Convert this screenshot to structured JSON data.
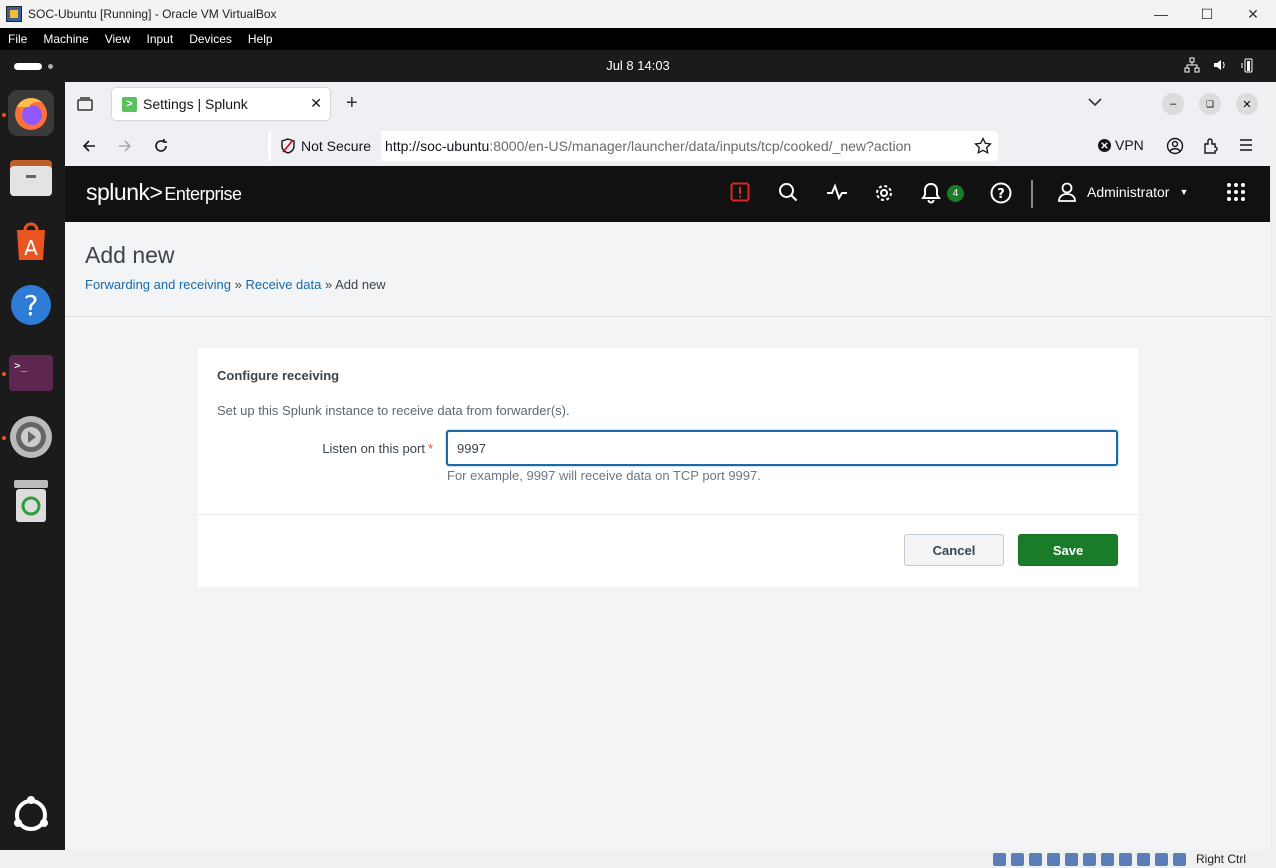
{
  "vbox": {
    "title": "SOC-Ubuntu [Running] - Oracle VM VirtualBox",
    "menu": [
      "File",
      "Machine",
      "View",
      "Input",
      "Devices",
      "Help"
    ],
    "host_key": "Right Ctrl"
  },
  "ubuntu": {
    "clock": "Jul 8  14:03"
  },
  "browser": {
    "tab_title": "Settings | Splunk",
    "security_label": "Not Secure",
    "url_host": "http://soc-ubuntu",
    "url_rest": ":8000/en-US/manager/launcher/data/inputs/tcp/cooked/_new?action",
    "vpn_label": "VPN"
  },
  "splunk": {
    "logo": "splunk>",
    "product": "Enterprise",
    "notification_count": "4",
    "user": "Administrator"
  },
  "page": {
    "title": "Add new",
    "breadcrumbs": [
      "Forwarding and receiving",
      "Receive data",
      "Add new"
    ],
    "separator": "»",
    "section_title": "Configure receiving",
    "description": "Set up this Splunk instance to receive data from forwarder(s).",
    "port_label": "Listen on this port",
    "required_mark": "*",
    "port_value": "9997",
    "help_text": "For example, 9997 will receive data on TCP port 9997.",
    "cancel_label": "Cancel",
    "save_label": "Save"
  },
  "colors": {
    "save": "#1a7c28",
    "link": "#1a6aa8",
    "splunkbar": "#111111",
    "alert": "#dc2626"
  }
}
